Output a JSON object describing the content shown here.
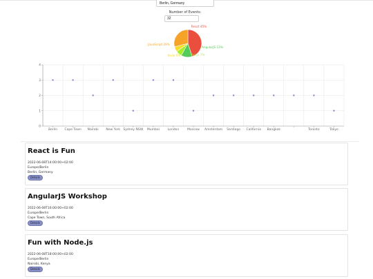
{
  "search": {
    "city_value": "Berlin, Germany"
  },
  "events_control": {
    "label": "Number of Events:",
    "value": "32"
  },
  "pie_chart": {
    "slices": [
      {
        "label": "React 45%",
        "value": 45,
        "color": "#ea4f3d"
      },
      {
        "label": "AngularJS 13%",
        "value": 13,
        "color": "#55c95a"
      },
      {
        "label": "Vue.js 7%",
        "value": 7,
        "color": "#a6ee2e"
      },
      {
        "label": "Node 6%",
        "value": 6,
        "color": "#f8dc2a"
      },
      {
        "label": "JavaScript 29%",
        "value": 29,
        "color": "#f7a32a"
      }
    ]
  },
  "chart_data": {
    "type": "scatter",
    "categories": [
      "Berlin",
      "Cape Town",
      "Nairobi",
      "New York",
      "Sydney NSW",
      "Mumbai",
      "London",
      "Moscow",
      "Amsterdam",
      "Santiago",
      "California",
      "Bangkok",
      "",
      "Toronto",
      "Tokyo"
    ],
    "values": [
      3,
      3,
      2,
      3,
      1,
      3,
      3,
      1,
      2,
      2,
      2,
      2,
      2,
      2,
      1
    ],
    "ylim": [
      0,
      4
    ],
    "yticks": [
      "0",
      "1",
      "2",
      "3",
      "4"
    ],
    "grid": true,
    "point_color": "#8884d8"
  },
  "events": [
    {
      "title": "React is Fun",
      "datetime": "2022-06-08T14:00:00+02:00",
      "timezone": "Europe/Berlin",
      "location": "Berlin, Germany",
      "button": "Details"
    },
    {
      "title": "AngularJS Workshop",
      "datetime": "2022-06-08T16:00:00+02:00",
      "timezone": "Europe/Berlin",
      "location": "Cape Town, South Africa",
      "button": "Details"
    },
    {
      "title": "Fun with Node.js",
      "datetime": "2022-06-08T18:00:00+02:00",
      "timezone": "Europe/Berlin",
      "location": "Nairobi, Kenya",
      "button": "Details"
    }
  ]
}
